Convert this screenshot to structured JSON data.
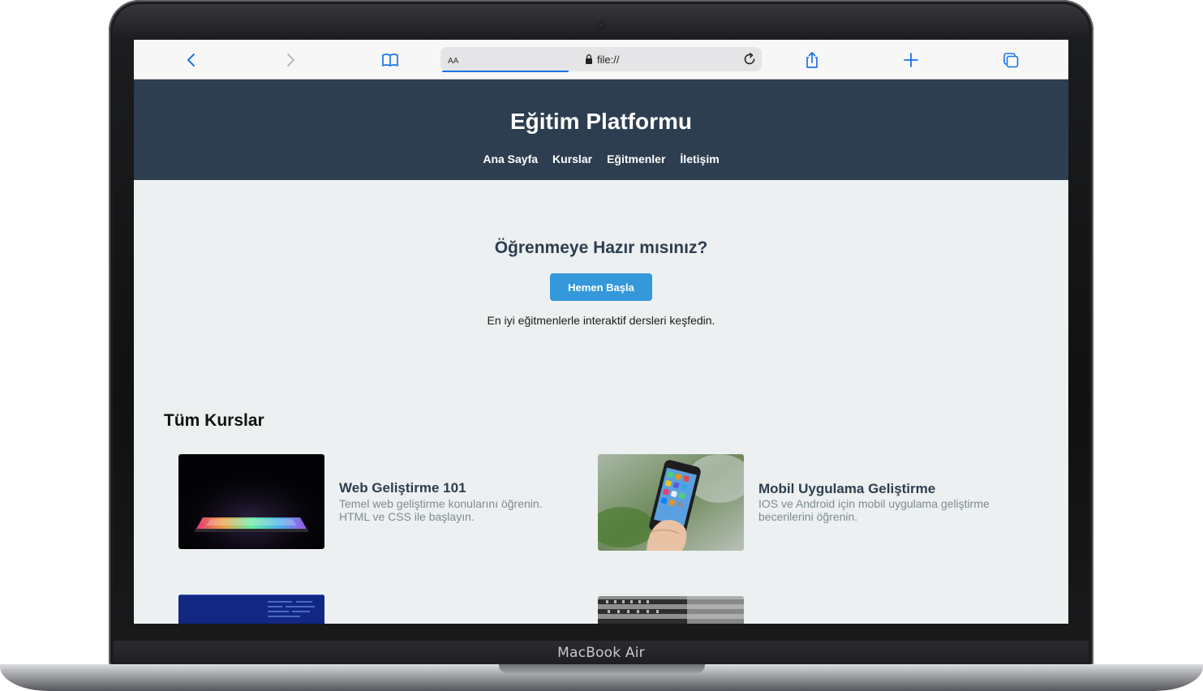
{
  "device": {
    "label": "MacBook Air"
  },
  "browser": {
    "text_size_label": "AA",
    "address": "file://",
    "icons": [
      "back-icon",
      "forward-icon",
      "bookmarks-icon",
      "lock-icon",
      "reload-icon",
      "share-icon",
      "new-tab-icon",
      "tabs-icon"
    ],
    "accent_color": "#1a73e8"
  },
  "site": {
    "title": "Eğitim Platformu",
    "nav": [
      "Ana Sayfa",
      "Kurslar",
      "Eğitmenler",
      "İletişim"
    ],
    "header_color": "#2c3e50"
  },
  "hero": {
    "title": "Öğrenmeye Hazır mısınız?",
    "button": "Hemen Başla",
    "subtitle": "En iyi eğitmenlerle interaktif dersleri keşfedin.",
    "button_color": "#3498db"
  },
  "courses": {
    "title": "Tüm Kurslar",
    "items": [
      {
        "name": "Web Geliştirme 101",
        "desc": "Temel web geliştirme konularını öğrenin. HTML ve CSS ile başlayın.",
        "image": "laptop-keyboard-image"
      },
      {
        "name": "Mobil Uygulama Geliştirme",
        "desc": "IOS ve Android için mobil uygulama geliştirme becerilerini öğrenin.",
        "image": "smartphone-in-hand-image"
      },
      {
        "name": "",
        "desc": "",
        "image": "code-screen-image"
      },
      {
        "name": "",
        "desc": "",
        "image": "server-rack-image"
      }
    ]
  }
}
